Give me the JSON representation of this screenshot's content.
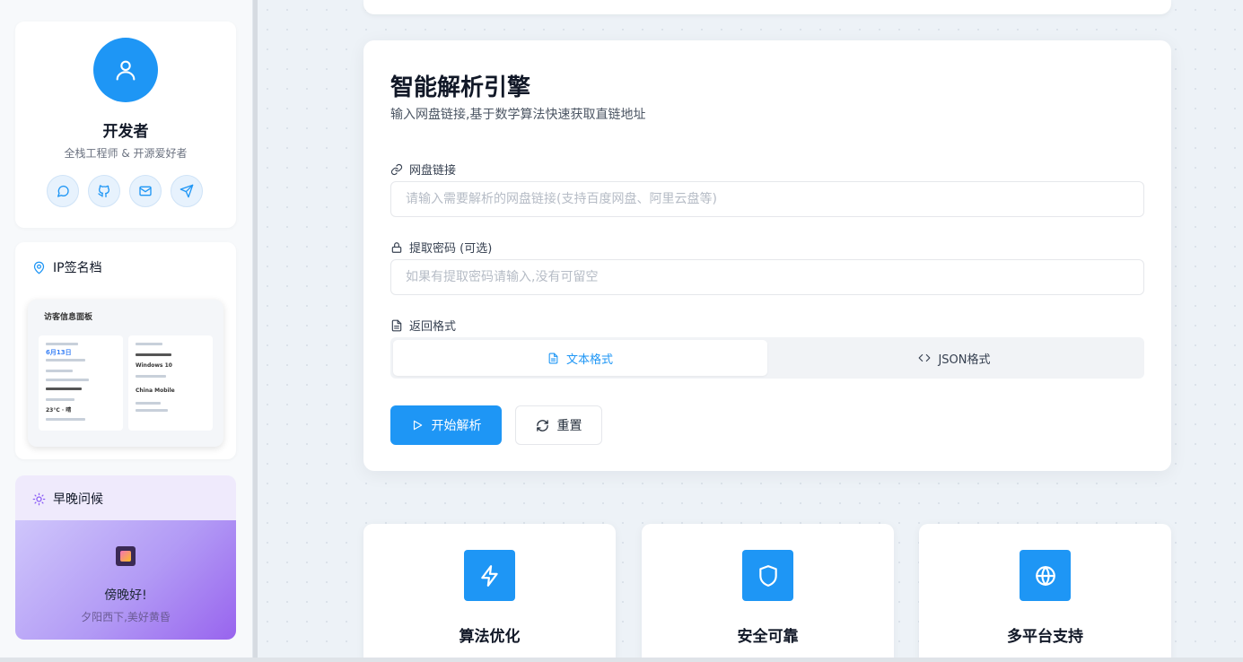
{
  "profile": {
    "name": "开发者",
    "role": "全栈工程师 & 开源爱好者",
    "social": [
      "chat-icon",
      "github-icon",
      "mail-icon",
      "send-icon"
    ]
  },
  "ip_card": {
    "title": "IP签名档",
    "preview": {
      "title": "访客信息面板",
      "date": "6月13日",
      "os": "Windows 10",
      "isp": "China Mobile",
      "weather": "23°C · 晴"
    }
  },
  "greeting": {
    "title": "早晚问候",
    "message": "傍晚好!",
    "sub": "夕阳西下,美好黄昏"
  },
  "engine": {
    "title": "智能解析引擎",
    "subtitle": "输入网盘链接,基于数学算法快速获取直链地址",
    "link_label": "网盘链接",
    "link_placeholder": "请输入需要解析的网盘链接(支持百度网盘、阿里云盘等)",
    "link_value": "",
    "pwd_label": "提取密码 (可选)",
    "pwd_placeholder": "如果有提取密码请输入,没有可留空",
    "pwd_value": "",
    "format_label": "返回格式",
    "formats": [
      {
        "label": "文本格式",
        "active": true
      },
      {
        "label": "JSON格式",
        "active": false
      }
    ],
    "start_label": "开始解析",
    "reset_label": "重置"
  },
  "features": [
    {
      "title": "算法优化",
      "icon": "lightning-icon"
    },
    {
      "title": "安全可靠",
      "icon": "shield-icon"
    },
    {
      "title": "多平台支持",
      "icon": "globe-icon"
    }
  ],
  "colors": {
    "accent": "#1e96f5",
    "greeting_gradient_end": "#9864ee"
  }
}
